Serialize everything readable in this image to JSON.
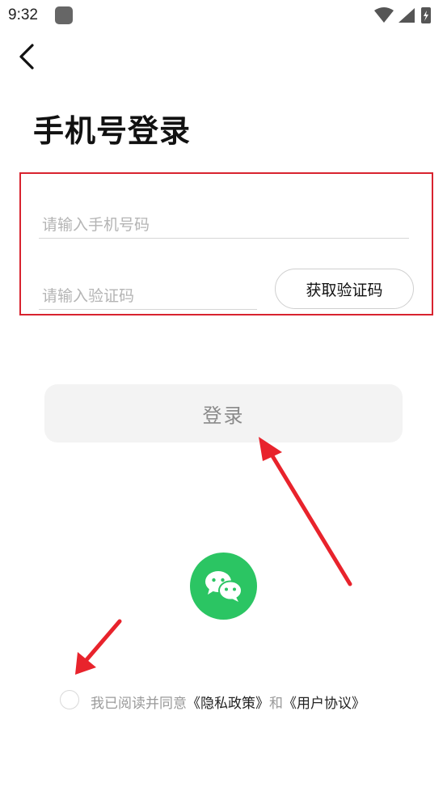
{
  "status_bar": {
    "time": "9:32"
  },
  "header": {
    "back_icon": "chevron-left-icon"
  },
  "page": {
    "title": "手机号登录"
  },
  "form": {
    "phone_placeholder": "请输入手机号码",
    "phone_value": "",
    "code_placeholder": "请输入验证码",
    "code_value": "",
    "get_code_label": "获取验证码",
    "highlight_color": "#d8232f"
  },
  "login_button": {
    "label": "登录"
  },
  "wechat": {
    "icon": "wechat-icon",
    "color": "#2bc563"
  },
  "agreement": {
    "checked": false,
    "prefix": "我已阅读并同意",
    "privacy_link": "《隐私政策》",
    "conjunction": "和",
    "user_link": "《用户协议》"
  },
  "annotations": {
    "arrow_color": "#e8232c"
  }
}
